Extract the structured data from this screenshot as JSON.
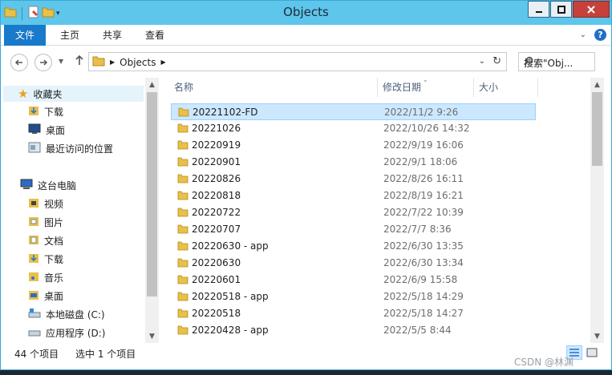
{
  "window": {
    "title": "Objects"
  },
  "ribbon": {
    "tabs": [
      "文件",
      "主页",
      "共享",
      "查看"
    ]
  },
  "address": {
    "path_root": "Objects",
    "search_placeholder": "搜索\"Obj..."
  },
  "nav": {
    "items": [
      {
        "label": "收藏夹",
        "icon": "star-icon"
      },
      {
        "label": "下载",
        "icon": "download-folder-icon"
      },
      {
        "label": "桌面",
        "icon": "desktop-icon"
      },
      {
        "label": "最近访问的位置",
        "icon": "recent-places-icon"
      },
      {
        "label": "这台电脑",
        "icon": "computer-icon"
      },
      {
        "label": "视频",
        "icon": "videos-folder-icon"
      },
      {
        "label": "图片",
        "icon": "pictures-folder-icon"
      },
      {
        "label": "文档",
        "icon": "documents-folder-icon"
      },
      {
        "label": "下载",
        "icon": "download-folder-icon"
      },
      {
        "label": "音乐",
        "icon": "music-folder-icon"
      },
      {
        "label": "桌面",
        "icon": "desktop-folder-icon"
      },
      {
        "label": "本地磁盘 (C:)",
        "icon": "drive-icon"
      },
      {
        "label": "应用程序 (D:)",
        "icon": "drive-icon"
      }
    ]
  },
  "columns": {
    "name": "名称",
    "date": "修改日期",
    "size": "大小"
  },
  "files": [
    {
      "name": "20221102-FD",
      "date": "2022/11/2 9:26"
    },
    {
      "name": "20221026",
      "date": "2022/10/26 14:32"
    },
    {
      "name": "20220919",
      "date": "2022/9/19 16:06"
    },
    {
      "name": "20220901",
      "date": "2022/9/1 18:06"
    },
    {
      "name": "20220826",
      "date": "2022/8/26 16:11"
    },
    {
      "name": "20220818",
      "date": "2022/8/19 16:21"
    },
    {
      "name": "20220722",
      "date": "2022/7/22 10:39"
    },
    {
      "name": "20220707",
      "date": "2022/7/7 8:36"
    },
    {
      "name": "20220630 - app",
      "date": "2022/6/30 13:35"
    },
    {
      "name": "20220630",
      "date": "2022/6/30 13:34"
    },
    {
      "name": "20220601",
      "date": "2022/6/9 15:58"
    },
    {
      "name": "20220518 - app",
      "date": "2022/5/18 14:29"
    },
    {
      "name": "20220518",
      "date": "2022/5/18 14:27"
    },
    {
      "name": "20220428 - app",
      "date": "2022/5/5 8:44"
    }
  ],
  "status": {
    "count": "44 个项目",
    "selected": "选中 1 个项目"
  },
  "watermark": "CSDN @林渊"
}
